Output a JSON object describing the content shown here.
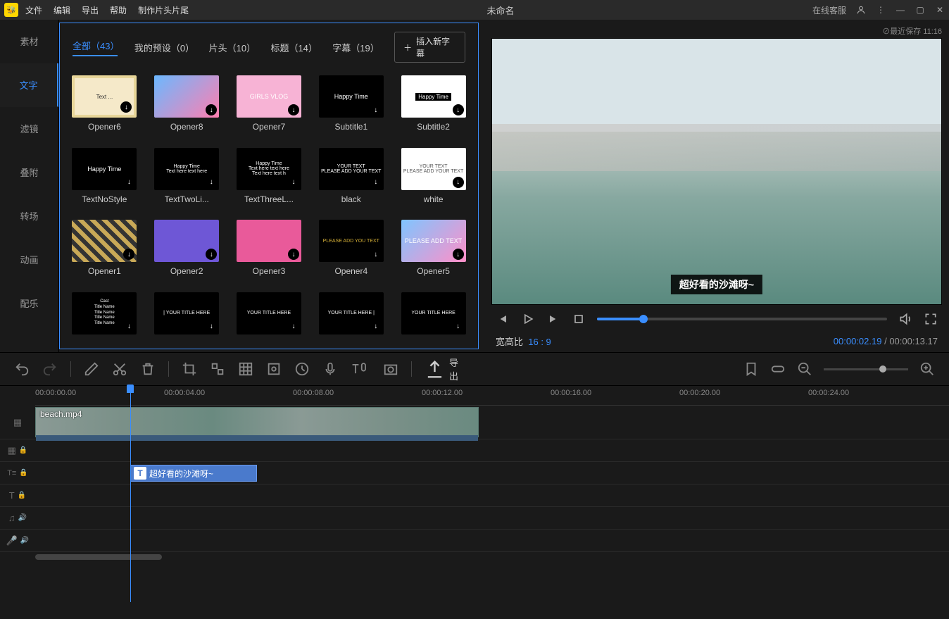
{
  "titlebar": {
    "menu": [
      "文件",
      "编辑",
      "导出",
      "帮助",
      "制作片头片尾"
    ],
    "title": "未命名",
    "online_service": "在线客服",
    "save_info": "⊘最近保存 11:16"
  },
  "sidebar": {
    "items": [
      "素材",
      "文字",
      "滤镜",
      "叠附",
      "转场",
      "动画",
      "配乐"
    ],
    "active_index": 1
  },
  "library": {
    "tabs": [
      {
        "label": "全部（43）",
        "active": true
      },
      {
        "label": "我的预设（0）"
      },
      {
        "label": "片头（10）"
      },
      {
        "label": "标题（14）"
      },
      {
        "label": "字幕（19）"
      }
    ],
    "add_button": "插入新字幕",
    "items": [
      {
        "name": "Opener6",
        "cls": "t-opener6"
      },
      {
        "name": "Opener8",
        "cls": "t-opener8"
      },
      {
        "name": "Opener7",
        "cls": "t-opener7",
        "text": "GIRLS VLOG"
      },
      {
        "name": "Subtitle1",
        "cls": "t-subtitle1",
        "text": "Happy Time"
      },
      {
        "name": "Subtitle2",
        "cls": "t-subtitle2",
        "badge": "Happy Time"
      },
      {
        "name": "TextNoStyle",
        "cls": "t-subtitle1",
        "text": "Happy Time"
      },
      {
        "name": "TextTwoLi...",
        "cls": "t-black",
        "text": "Happy Time\nText here text here"
      },
      {
        "name": "TextThreeL...",
        "cls": "t-black",
        "text": "Happy Time\nText here text here\nText here text h"
      },
      {
        "name": "black",
        "cls": "t-black",
        "text": "YOUR TEXT\nPLEASE ADD YOUR TEXT"
      },
      {
        "name": "white",
        "cls": "t-white",
        "text": "YOUR TEXT\nPLEASE ADD YOUR TEXT"
      },
      {
        "name": "Opener1",
        "cls": "t-op1"
      },
      {
        "name": "Opener2",
        "cls": "t-op2"
      },
      {
        "name": "Opener3",
        "cls": "t-op3"
      },
      {
        "name": "Opener4",
        "cls": "t-op4",
        "text": "PLEASE ADD YOU TEXT"
      },
      {
        "name": "Opener5",
        "cls": "t-op5",
        "text": "PLEASE ADD TEXT"
      },
      {
        "name": "",
        "cls": "t-cast",
        "text": "Cast\nTitle Name\nTitle Name\nTitle Name\nTitle Name"
      },
      {
        "name": "",
        "cls": "t-title1",
        "text": "| YOUR TITLE HERE"
      },
      {
        "name": "",
        "cls": "t-title2",
        "text": "YOUR TITLE HERE"
      },
      {
        "name": "",
        "cls": "t-title3",
        "text": "YOUR TITLE HERE |"
      },
      {
        "name": "",
        "cls": "t-title4",
        "text": "YOUR TITLE HERE"
      }
    ]
  },
  "preview": {
    "subtitle_overlay": "超好看的沙滩呀~",
    "aspect_label": "宽高比",
    "aspect_value": "16 : 9",
    "time_current": "00:00:02.19",
    "time_total": "00:00:13.17"
  },
  "toolbar": {
    "export": "导出"
  },
  "timeline": {
    "ruler": [
      "00:00:00.00",
      "00:00:04.00",
      "00:00:08.00",
      "00:00:12.00",
      "00:00:16.00",
      "00:00:20.00",
      "00:00:24.00"
    ],
    "video_clip": "beach.mp4",
    "text_clip": "超好看的沙滩呀~"
  }
}
